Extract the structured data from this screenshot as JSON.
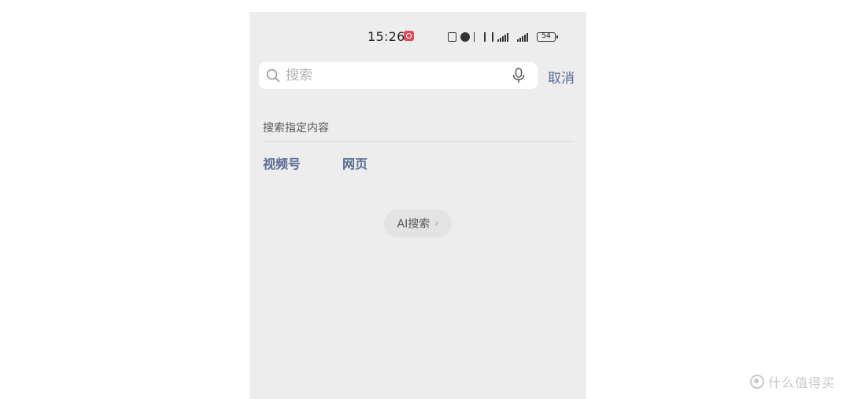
{
  "status_bar": {
    "time": "15:26",
    "battery": "54",
    "icons": [
      "nfc-icon",
      "alarm-icon",
      "bluetooth-icon",
      "vibrate-icon",
      "signal-5g-icon",
      "signal-5g-icon",
      "battery-icon"
    ]
  },
  "search": {
    "placeholder": "搜索",
    "value": "",
    "icon": "search-icon",
    "voice_icon": "mic-icon"
  },
  "cancel_label": "取消",
  "section": {
    "label": "搜索指定内容",
    "categories": [
      "视频号",
      "网页"
    ]
  },
  "ai_search": {
    "label": "AI搜索",
    "chevron": "›"
  },
  "watermark": {
    "text": "什么值得买"
  },
  "colors": {
    "background": "#ededed",
    "link": "#576b95",
    "pill": "#e3e3e3"
  }
}
